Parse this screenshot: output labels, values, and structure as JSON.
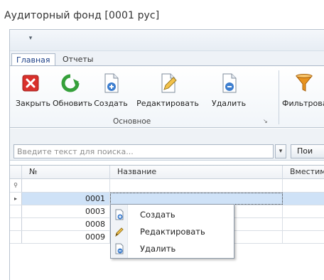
{
  "window": {
    "title": "Аудиторный фонд [0001 рус]"
  },
  "qat": {
    "icon": "quick-access-dropdown-icon",
    "glyph": "▾"
  },
  "tabs": [
    {
      "label": "Главная"
    },
    {
      "label": "Отчеты"
    }
  ],
  "ribbon": {
    "buttons": [
      {
        "label": "Закрыть",
        "icon": "close-icon"
      },
      {
        "label": "Обновить",
        "icon": "refresh-icon"
      },
      {
        "label": "Создать",
        "icon": "create-document-icon"
      },
      {
        "label": "Редактировать",
        "icon": "edit-document-icon"
      },
      {
        "label": "Удалить",
        "icon": "delete-document-icon"
      },
      {
        "label": "Фильтрова",
        "icon": "filter-icon"
      }
    ],
    "group_label": "Основное",
    "launcher_glyph": "↘"
  },
  "search": {
    "placeholder": "Введите текст для поиска...",
    "dropdown_glyph": "▾",
    "find_label": "Пои"
  },
  "grid": {
    "columns": [
      "№",
      "Название",
      "Вместимос"
    ],
    "filter_glyph": "⚲",
    "current_glyph": "▸",
    "rows": [
      {
        "num": "0001",
        "name": "",
        "capacity": ""
      },
      {
        "num": "0003",
        "name": "",
        "capacity": ""
      },
      {
        "num": "0008",
        "name": "",
        "capacity": ""
      },
      {
        "num": "0009",
        "name": "",
        "capacity": ""
      }
    ]
  },
  "context_menu": {
    "items": [
      {
        "label": "Создать",
        "icon": "create-document-icon"
      },
      {
        "label": "Редактировать",
        "icon": "edit-pencil-icon"
      },
      {
        "label": "Удалить",
        "icon": "delete-document-icon"
      }
    ]
  },
  "colors": {
    "selection": "#cfe2f7",
    "close_red": "#d9302b",
    "refresh_green": "#35a03a",
    "doc_blue": "#3d7ecf",
    "filter_orange": "#e8931f"
  }
}
